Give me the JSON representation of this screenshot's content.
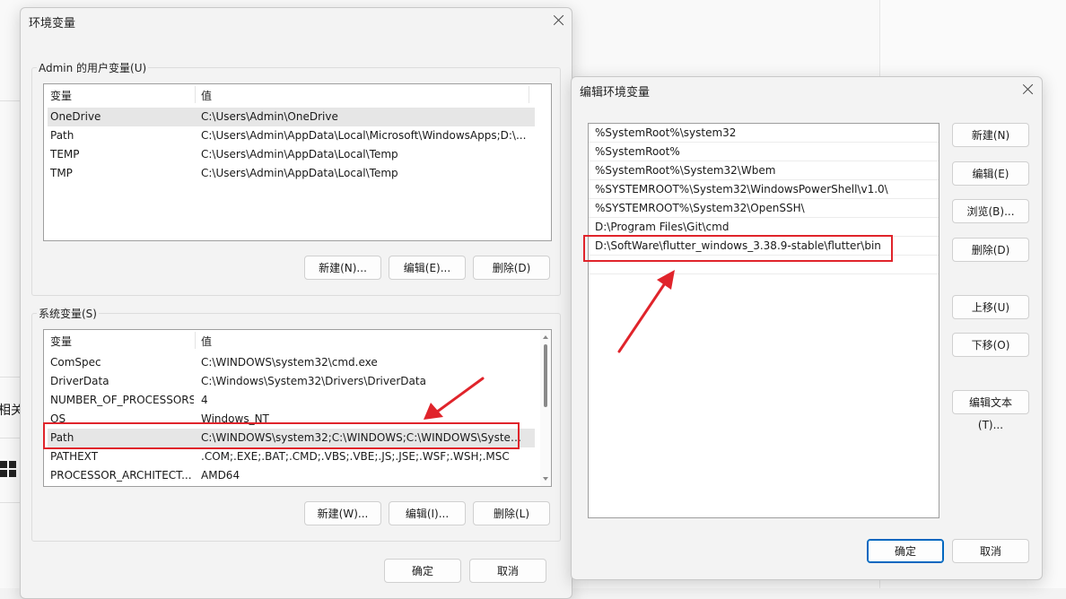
{
  "background": {
    "partial_text": "相关"
  },
  "env_dialog": {
    "title": "环境变量",
    "user_group_label": "Admin 的用户变量(U)",
    "user_table": {
      "headers": [
        "变量",
        "值"
      ],
      "rows": [
        {
          "name": "OneDrive",
          "value": "C:\\Users\\Admin\\OneDrive"
        },
        {
          "name": "Path",
          "value": "C:\\Users\\Admin\\AppData\\Local\\Microsoft\\WindowsApps;D:\\..."
        },
        {
          "name": "TEMP",
          "value": "C:\\Users\\Admin\\AppData\\Local\\Temp"
        },
        {
          "name": "TMP",
          "value": "C:\\Users\\Admin\\AppData\\Local\\Temp"
        }
      ]
    },
    "user_buttons": {
      "new": "新建(N)...",
      "edit": "编辑(E)...",
      "delete": "删除(D)"
    },
    "system_group_label": "系统变量(S)",
    "system_table": {
      "headers": [
        "变量",
        "值"
      ],
      "rows": [
        {
          "name": "ComSpec",
          "value": "C:\\WINDOWS\\system32\\cmd.exe"
        },
        {
          "name": "DriverData",
          "value": "C:\\Windows\\System32\\Drivers\\DriverData"
        },
        {
          "name": "NUMBER_OF_PROCESSORS",
          "value": "4"
        },
        {
          "name": "OS",
          "value": "Windows_NT"
        },
        {
          "name": "Path",
          "value": "C:\\WINDOWS\\system32;C:\\WINDOWS;C:\\WINDOWS\\System..."
        },
        {
          "name": "PATHEXT",
          "value": ".COM;.EXE;.BAT;.CMD;.VBS;.VBE;.JS;.JSE;.WSF;.WSH;.MSC"
        },
        {
          "name": "PROCESSOR_ARCHITECT...",
          "value": "AMD64"
        }
      ]
    },
    "system_buttons": {
      "new": "新建(W)...",
      "edit": "编辑(I)...",
      "delete": "删除(L)"
    },
    "ok": "确定",
    "cancel": "取消"
  },
  "edit_dialog": {
    "title": "编辑环境变量",
    "paths": [
      "%SystemRoot%\\system32",
      "%SystemRoot%",
      "%SystemRoot%\\System32\\Wbem",
      "%SYSTEMROOT%\\System32\\WindowsPowerShell\\v1.0\\",
      "%SYSTEMROOT%\\System32\\OpenSSH\\",
      "D:\\Program Files\\Git\\cmd",
      "D:\\SoftWare\\flutter_windows_3.38.9-stable\\flutter\\bin"
    ],
    "buttons": {
      "new": "新建(N)",
      "edit": "编辑(E)",
      "browse": "浏览(B)...",
      "delete": "删除(D)",
      "move_up": "上移(U)",
      "move_down": "下移(O)",
      "edit_text": "编辑文本(T)..."
    },
    "ok": "确定",
    "cancel": "取消"
  },
  "annotation_color": "#e0242b",
  "icons": [
    "close-icon",
    "windows-logo-icon",
    "scroll-up-icon",
    "scroll-down-icon",
    "annotation-arrow-icon"
  ]
}
